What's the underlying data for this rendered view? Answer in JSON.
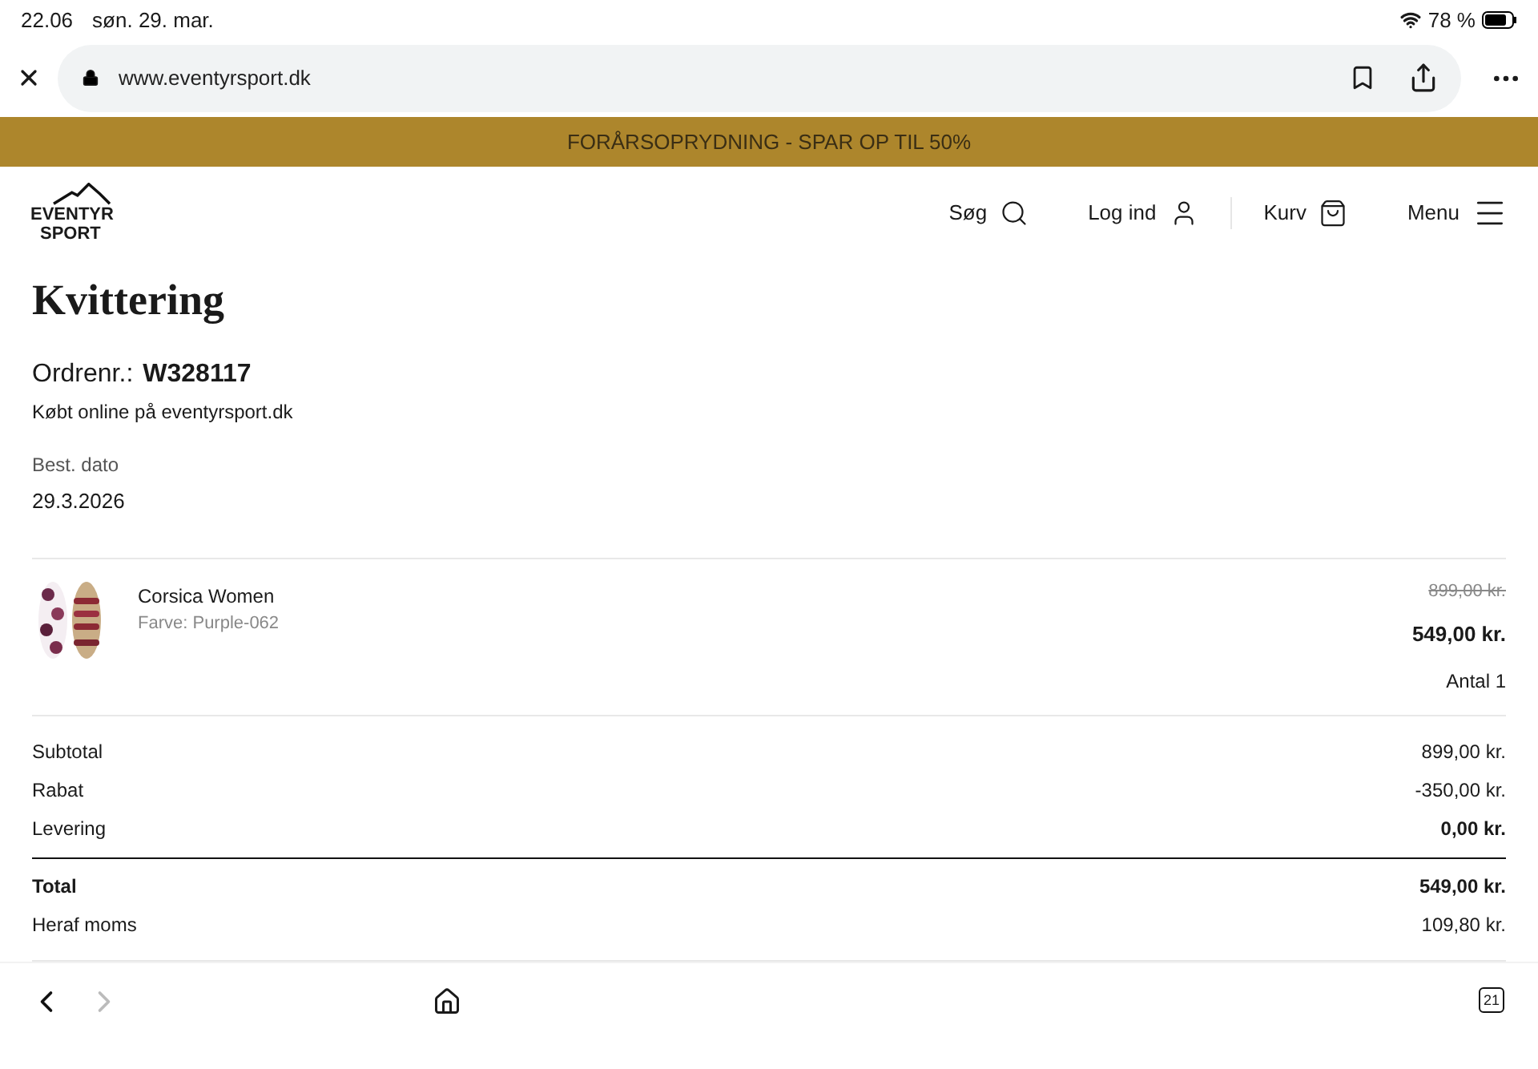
{
  "status_bar": {
    "time": "22.06",
    "date": "søn. 29. mar.",
    "battery": "78 %"
  },
  "browser": {
    "url": "www.eventyrsport.dk"
  },
  "banner": "FORÅRSOPRYDNING - SPAR OP TIL 50%",
  "logo": {
    "line1": "EVENTYR",
    "line2": "SPORT"
  },
  "nav": [
    {
      "label": "Søg"
    },
    {
      "label": "Log ind"
    },
    {
      "label": "Kurv"
    },
    {
      "label": "Menu"
    }
  ],
  "title": "Kvittering",
  "order": {
    "label": "Ordrenr.:",
    "number": "W328117",
    "channel": "Købt online på eventyrsport.dk",
    "date_label": "Best. dato",
    "date": "29.3.2026"
  },
  "items": [
    {
      "kind": "picture",
      "name": "Corsica Women",
      "variant": "Farve: Purple-062",
      "old_price": "899,00 kr.",
      "price": "549,00 kr.",
      "quantity": "Antal 1"
    }
  ],
  "totals": [
    {
      "label": "Subtotal",
      "value": "899,00 kr.",
      "label_bold": false,
      "value_bold": false,
      "rule_before": false
    },
    {
      "label": "Rabat",
      "value": "-350,00 kr.",
      "label_bold": false,
      "value_bold": false,
      "rule_before": false
    },
    {
      "label": "Levering",
      "value": "0,00 kr.",
      "label_bold": false,
      "value_bold": true,
      "rule_before": false
    },
    {
      "label": "Total",
      "value": "549,00 kr.",
      "label_bold": true,
      "value_bold": true,
      "rule_before": true
    },
    {
      "label": "Heraf moms",
      "value": "109,80 kr.",
      "label_bold": false,
      "value_bold": false,
      "rule_before": false
    }
  ],
  "toolbar": {
    "back_disabled": false,
    "forward_disabled": true,
    "tabs": "21"
  }
}
